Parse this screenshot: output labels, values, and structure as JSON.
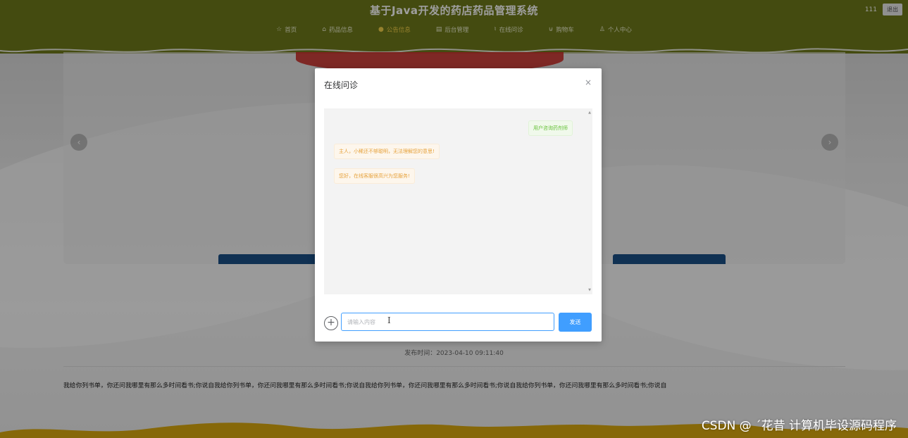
{
  "header": {
    "title": "基于Java开发的药店药品管理系统",
    "username": "111",
    "logout_label": "退出",
    "nav": [
      {
        "icon": "☆",
        "icon_name": "star-icon",
        "label": "首页"
      },
      {
        "icon": "⌂",
        "icon_name": "home-icon",
        "label": "药品信息"
      },
      {
        "icon": "●",
        "icon_name": "dot-icon",
        "label": "公告信息"
      },
      {
        "icon": "▤",
        "icon_name": "grid-icon",
        "label": "后台管理"
      },
      {
        "icon": "♮",
        "icon_name": "headset-icon",
        "label": "在线问诊"
      },
      {
        "icon": "⊍",
        "icon_name": "cart-icon",
        "label": "购物车"
      },
      {
        "icon": "♙",
        "icon_name": "user-icon",
        "label": "个人中心"
      }
    ]
  },
  "article": {
    "publish_time": "发布时间：2023-04-10 09:11:40",
    "body": "我给你列书单，你还问我哪里有那么多时间看书;你说自我给你列书单，你还问我哪里有那么多时间看书;你说自我给你列书单，你还问我哪里有那么多时间看书;你说自我给你列书单，你还问我哪里有那么多时间看书;你说自"
  },
  "carousel": {
    "prev_icon": "‹",
    "next_icon": "›"
  },
  "modal": {
    "title": "在线问诊",
    "close_icon": "×",
    "messages": [
      {
        "from": "user",
        "text": "用户咨询药剂师"
      },
      {
        "from": "bot",
        "text": "主人，小稀还不够聪明，无法理解您的意思!"
      },
      {
        "from": "bot",
        "text": "您好，在线客服很高兴为您服务!"
      }
    ],
    "input": {
      "placeholder": "请输入内容",
      "value": ""
    },
    "send_label": "发送",
    "plus_icon": "+"
  },
  "watermark": "CSDN @ ˊ花昔 计算机毕设源码程序",
  "colors": {
    "header": "#6f7a1b",
    "active_nav": "#f3d04a",
    "primary": "#409eff",
    "user_bubble_text": "#67c23a",
    "bot_bubble_text": "#e6a23c"
  }
}
